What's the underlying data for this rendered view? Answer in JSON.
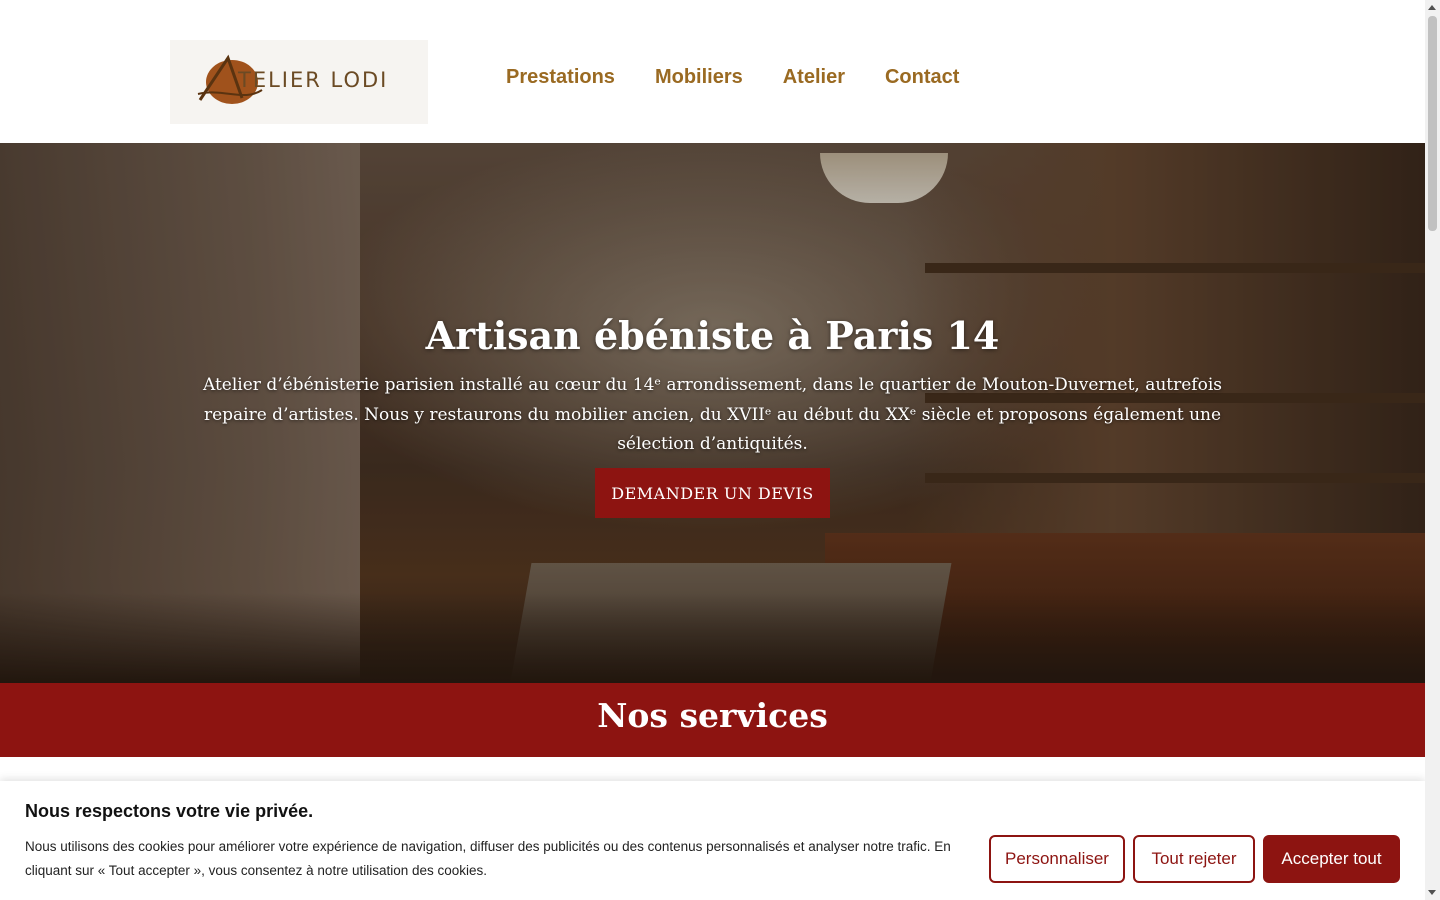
{
  "header": {
    "logo_text": "TELIER LODI",
    "nav": [
      "Prestations",
      "Mobiliers",
      "Atelier",
      "Contact"
    ]
  },
  "hero": {
    "title": "Artisan ébéniste à Paris 14",
    "text": "Atelier d’ébénisterie parisien installé au cœur du 14ᵉ arrondissement, dans le quartier de Mouton-Duvernet, autrefois repaire d’artistes. Nous y restaurons du mobilier ancien, du XVIIᵉ au début du XXᵉ siècle et proposons également une sélection d’antiquités.",
    "button": "DEMANDER UN DEVIS"
  },
  "services": {
    "title": "Nos services"
  },
  "cookie": {
    "title": "Nous respectons votre vie privée.",
    "text": "Nous utilisons des cookies pour améliorer votre expérience de navigation, diffuser des publicités ou des contenus personnalisés et analyser notre trafic. En cliquant sur « Tout accepter », vous consentez à notre utilisation des cookies.",
    "customize": "Personnaliser",
    "reject": "Tout rejeter",
    "accept": "Accepter tout"
  },
  "colors": {
    "accent": "#8d1411",
    "nav": "#9a6a22"
  }
}
